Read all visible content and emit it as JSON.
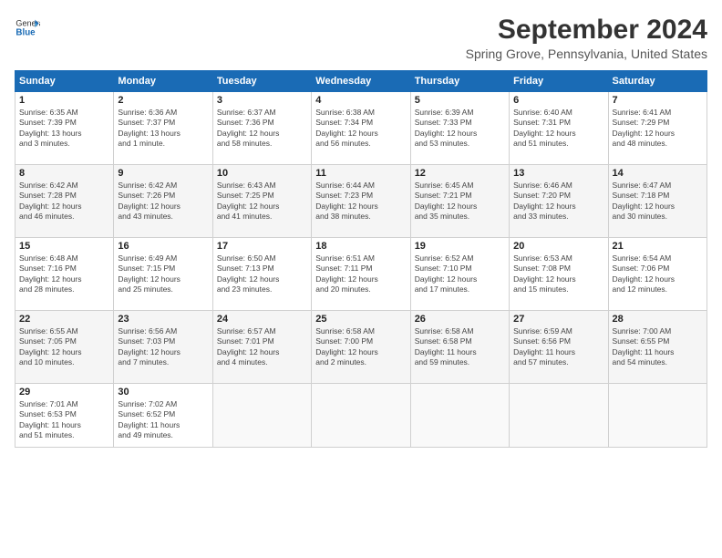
{
  "header": {
    "logo_general": "General",
    "logo_blue": "Blue",
    "title": "September 2024",
    "subtitle": "Spring Grove, Pennsylvania, United States"
  },
  "weekdays": [
    "Sunday",
    "Monday",
    "Tuesday",
    "Wednesday",
    "Thursday",
    "Friday",
    "Saturday"
  ],
  "weeks": [
    [
      {
        "day": "1",
        "info": "Sunrise: 6:35 AM\nSunset: 7:39 PM\nDaylight: 13 hours\nand 3 minutes."
      },
      {
        "day": "2",
        "info": "Sunrise: 6:36 AM\nSunset: 7:37 PM\nDaylight: 13 hours\nand 1 minute."
      },
      {
        "day": "3",
        "info": "Sunrise: 6:37 AM\nSunset: 7:36 PM\nDaylight: 12 hours\nand 58 minutes."
      },
      {
        "day": "4",
        "info": "Sunrise: 6:38 AM\nSunset: 7:34 PM\nDaylight: 12 hours\nand 56 minutes."
      },
      {
        "day": "5",
        "info": "Sunrise: 6:39 AM\nSunset: 7:33 PM\nDaylight: 12 hours\nand 53 minutes."
      },
      {
        "day": "6",
        "info": "Sunrise: 6:40 AM\nSunset: 7:31 PM\nDaylight: 12 hours\nand 51 minutes."
      },
      {
        "day": "7",
        "info": "Sunrise: 6:41 AM\nSunset: 7:29 PM\nDaylight: 12 hours\nand 48 minutes."
      }
    ],
    [
      {
        "day": "8",
        "info": "Sunrise: 6:42 AM\nSunset: 7:28 PM\nDaylight: 12 hours\nand 46 minutes."
      },
      {
        "day": "9",
        "info": "Sunrise: 6:42 AM\nSunset: 7:26 PM\nDaylight: 12 hours\nand 43 minutes."
      },
      {
        "day": "10",
        "info": "Sunrise: 6:43 AM\nSunset: 7:25 PM\nDaylight: 12 hours\nand 41 minutes."
      },
      {
        "day": "11",
        "info": "Sunrise: 6:44 AM\nSunset: 7:23 PM\nDaylight: 12 hours\nand 38 minutes."
      },
      {
        "day": "12",
        "info": "Sunrise: 6:45 AM\nSunset: 7:21 PM\nDaylight: 12 hours\nand 35 minutes."
      },
      {
        "day": "13",
        "info": "Sunrise: 6:46 AM\nSunset: 7:20 PM\nDaylight: 12 hours\nand 33 minutes."
      },
      {
        "day": "14",
        "info": "Sunrise: 6:47 AM\nSunset: 7:18 PM\nDaylight: 12 hours\nand 30 minutes."
      }
    ],
    [
      {
        "day": "15",
        "info": "Sunrise: 6:48 AM\nSunset: 7:16 PM\nDaylight: 12 hours\nand 28 minutes."
      },
      {
        "day": "16",
        "info": "Sunrise: 6:49 AM\nSunset: 7:15 PM\nDaylight: 12 hours\nand 25 minutes."
      },
      {
        "day": "17",
        "info": "Sunrise: 6:50 AM\nSunset: 7:13 PM\nDaylight: 12 hours\nand 23 minutes."
      },
      {
        "day": "18",
        "info": "Sunrise: 6:51 AM\nSunset: 7:11 PM\nDaylight: 12 hours\nand 20 minutes."
      },
      {
        "day": "19",
        "info": "Sunrise: 6:52 AM\nSunset: 7:10 PM\nDaylight: 12 hours\nand 17 minutes."
      },
      {
        "day": "20",
        "info": "Sunrise: 6:53 AM\nSunset: 7:08 PM\nDaylight: 12 hours\nand 15 minutes."
      },
      {
        "day": "21",
        "info": "Sunrise: 6:54 AM\nSunset: 7:06 PM\nDaylight: 12 hours\nand 12 minutes."
      }
    ],
    [
      {
        "day": "22",
        "info": "Sunrise: 6:55 AM\nSunset: 7:05 PM\nDaylight: 12 hours\nand 10 minutes."
      },
      {
        "day": "23",
        "info": "Sunrise: 6:56 AM\nSunset: 7:03 PM\nDaylight: 12 hours\nand 7 minutes."
      },
      {
        "day": "24",
        "info": "Sunrise: 6:57 AM\nSunset: 7:01 PM\nDaylight: 12 hours\nand 4 minutes."
      },
      {
        "day": "25",
        "info": "Sunrise: 6:58 AM\nSunset: 7:00 PM\nDaylight: 12 hours\nand 2 minutes."
      },
      {
        "day": "26",
        "info": "Sunrise: 6:58 AM\nSunset: 6:58 PM\nDaylight: 11 hours\nand 59 minutes."
      },
      {
        "day": "27",
        "info": "Sunrise: 6:59 AM\nSunset: 6:56 PM\nDaylight: 11 hours\nand 57 minutes."
      },
      {
        "day": "28",
        "info": "Sunrise: 7:00 AM\nSunset: 6:55 PM\nDaylight: 11 hours\nand 54 minutes."
      }
    ],
    [
      {
        "day": "29",
        "info": "Sunrise: 7:01 AM\nSunset: 6:53 PM\nDaylight: 11 hours\nand 51 minutes."
      },
      {
        "day": "30",
        "info": "Sunrise: 7:02 AM\nSunset: 6:52 PM\nDaylight: 11 hours\nand 49 minutes."
      },
      {
        "day": "",
        "info": ""
      },
      {
        "day": "",
        "info": ""
      },
      {
        "day": "",
        "info": ""
      },
      {
        "day": "",
        "info": ""
      },
      {
        "day": "",
        "info": ""
      }
    ]
  ]
}
